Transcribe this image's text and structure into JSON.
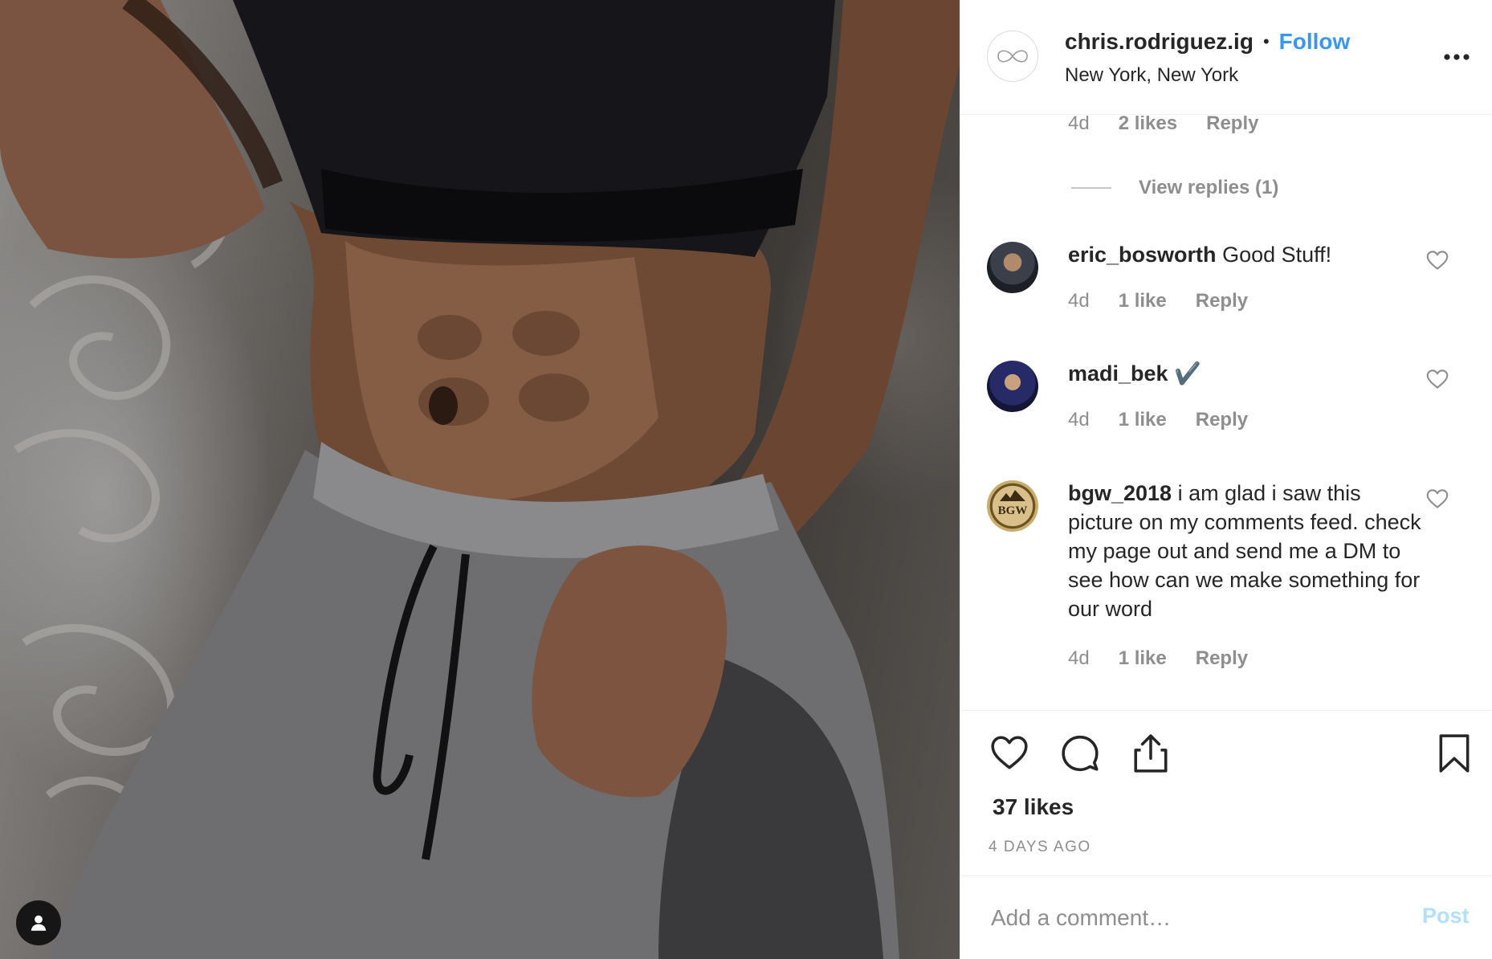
{
  "header": {
    "username": "chris.rodriguez.ig",
    "separator": "•",
    "follow_label": "Follow",
    "location": "New York, New York"
  },
  "top_reply_meta": {
    "time": "4d",
    "likes": "2 likes",
    "reply": "Reply"
  },
  "view_replies": "View replies (1)",
  "comments": [
    {
      "username": "eric_bosworth",
      "text": "Good Stuff!",
      "time": "4d",
      "likes": "1 like",
      "reply": "Reply"
    },
    {
      "username": "madi_bek",
      "text": "✔️",
      "time": "4d",
      "likes": "1 like",
      "reply": "Reply"
    },
    {
      "username": "bgw_2018",
      "text": "i am glad i saw this picture on my comments feed. check my page out and send me a DM to see how can we make something for our word",
      "time": "4d",
      "likes": "1 like",
      "reply": "Reply",
      "avatar_text": "BGW"
    }
  ],
  "post": {
    "likes": "37 likes",
    "age": "4 DAYS AGO"
  },
  "add_comment": {
    "placeholder": "Add a comment…",
    "post_label": "Post"
  },
  "colors": {
    "link": "#3897f0",
    "muted": "#8e8e8e",
    "post_disabled": "#b2dffc",
    "border": "#efefef"
  },
  "icons": [
    "user-tag-icon",
    "more-options-icon",
    "heart-icon",
    "comment-icon",
    "share-icon",
    "bookmark-icon"
  ]
}
